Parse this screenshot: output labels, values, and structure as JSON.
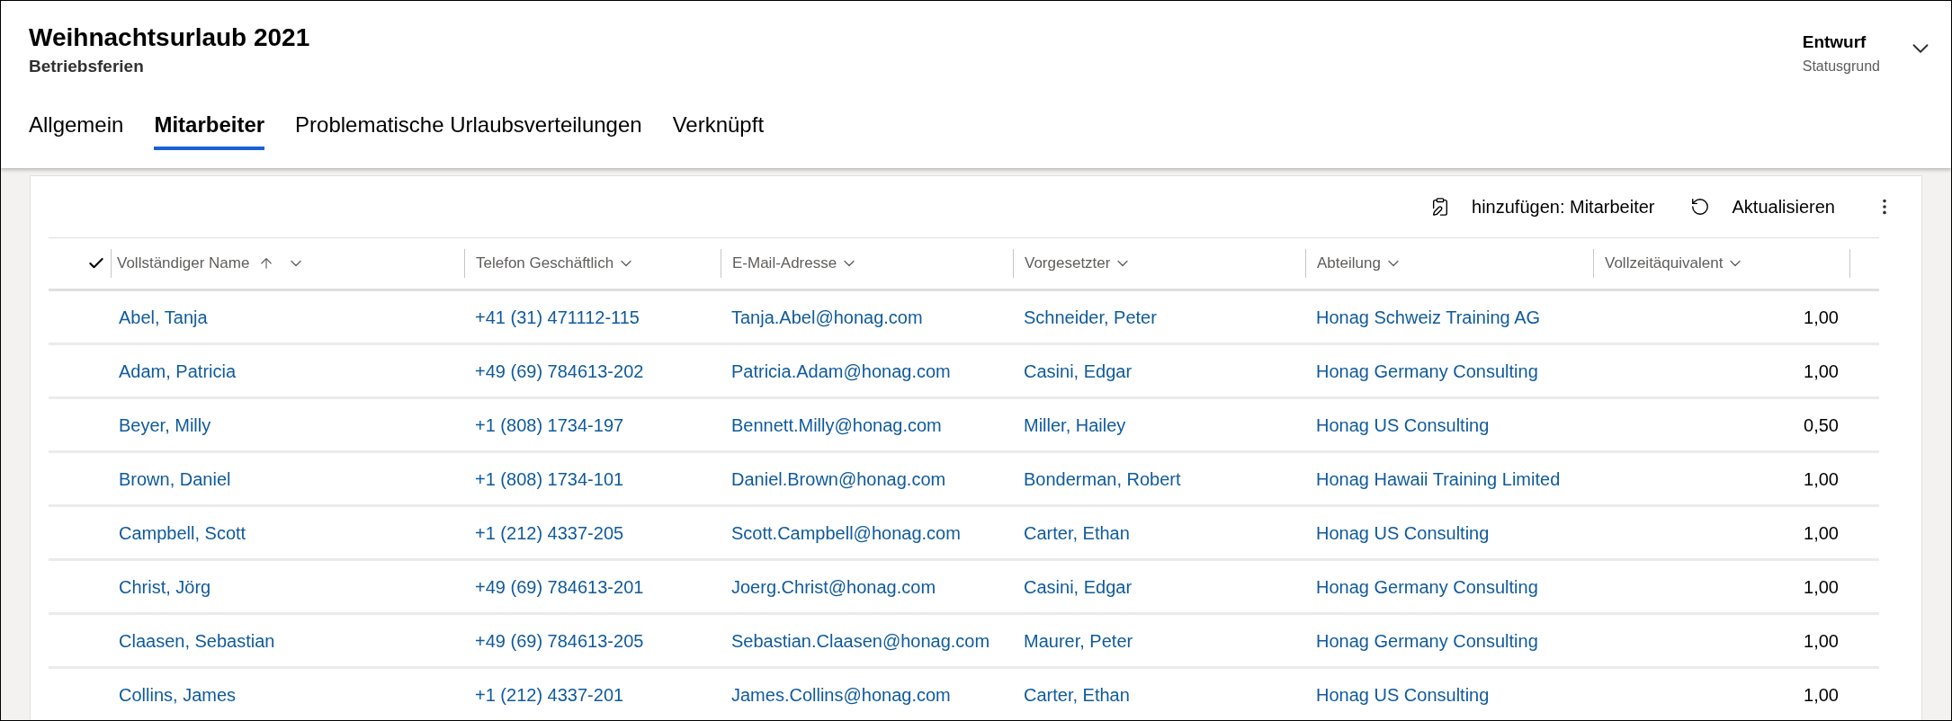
{
  "header": {
    "title": "Weihnachtsurlaub 2021",
    "subtitle": "Betriebsferien",
    "status": "Entwurf",
    "status_label": "Statusgrund"
  },
  "tabs": [
    {
      "label": "Allgemein",
      "selected": false
    },
    {
      "label": "Mitarbeiter",
      "selected": true
    },
    {
      "label": "Problematische Urlaubsverteilungen",
      "selected": false
    },
    {
      "label": "Verknüpft",
      "selected": false
    }
  ],
  "toolbar": {
    "add": "hinzufügen: Mitarbeiter",
    "refresh": "Aktualisieren"
  },
  "table": {
    "columns": [
      {
        "label": "Vollständiger Name",
        "sorted": true
      },
      {
        "label": "Telefon Geschäftlich",
        "sorted": false
      },
      {
        "label": "E-Mail-Adresse",
        "sorted": false
      },
      {
        "label": "Vorgesetzter",
        "sorted": false
      },
      {
        "label": "Abteilung",
        "sorted": false
      },
      {
        "label": "Vollzeitäquivalent",
        "sorted": false
      }
    ],
    "rows": [
      [
        "Abel, Tanja",
        "+41 (31) 471112-115",
        "Tanja.Abel@honag.com",
        "Schneider, Peter",
        "Honag Schweiz Training AG",
        "1,00"
      ],
      [
        "Adam, Patricia",
        "+49 (69) 784613-202",
        "Patricia.Adam@honag.com",
        "Casini, Edgar",
        "Honag Germany Consulting",
        "1,00"
      ],
      [
        "Beyer, Milly",
        "+1 (808) 1734-197",
        "Bennett.Milly@honag.com",
        "Miller, Hailey",
        "Honag US Consulting",
        "0,50"
      ],
      [
        "Brown, Daniel",
        "+1 (808) 1734-101",
        "Daniel.Brown@honag.com",
        "Bonderman, Robert",
        "Honag Hawaii Training Limited",
        "1,00"
      ],
      [
        "Campbell, Scott",
        "+1 (212) 4337-205",
        "Scott.Campbell@honag.com",
        "Carter, Ethan",
        "Honag US Consulting",
        "1,00"
      ],
      [
        "Christ, Jörg",
        "+49 (69) 784613-201",
        "Joerg.Christ@honag.com",
        "Casini, Edgar",
        "Honag Germany Consulting",
        "1,00"
      ],
      [
        "Claasen, Sebastian",
        "+49 (69) 784613-205",
        "Sebastian.Claasen@honag.com",
        "Maurer, Peter",
        "Honag Germany Consulting",
        "1,00"
      ],
      [
        "Collins, James",
        "+1 (212) 4337-201",
        "James.Collins@honag.com",
        "Carter, Ethan",
        "Honag US Consulting",
        "1,00"
      ]
    ]
  }
}
